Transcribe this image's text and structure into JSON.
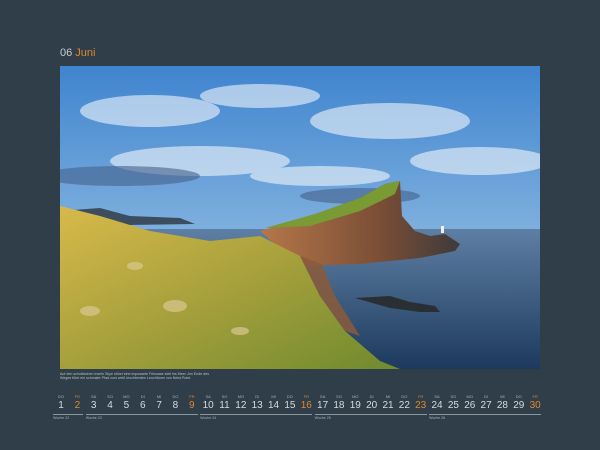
{
  "header": {
    "number": "06",
    "month": "Juni"
  },
  "photo": {
    "subject": "coastal-cliffs-with-lighthouse-at-sunset",
    "colors": {
      "sky": "#4f8fd0",
      "sea": "#2b4f78",
      "grass": "#b9a23a",
      "cliff": "#8a5a3a"
    }
  },
  "caption": "Auf den schottischen Inseln Skye stürzt eine imposante Felsnase steil ins Meer. Am Ende des Weges führt ein schmaler Pfad zum weiß leuchtenden Leuchtturm von Neist Point.",
  "calendar": {
    "days": [
      {
        "num": "1",
        "wd": "DO",
        "weekend": false
      },
      {
        "num": "2",
        "wd": "FR",
        "weekend": true
      },
      {
        "num": "3",
        "wd": "SA",
        "weekend": false
      },
      {
        "num": "4",
        "wd": "SO",
        "weekend": false
      },
      {
        "num": "5",
        "wd": "MO",
        "weekend": false
      },
      {
        "num": "6",
        "wd": "DI",
        "weekend": false
      },
      {
        "num": "7",
        "wd": "MI",
        "weekend": false
      },
      {
        "num": "8",
        "wd": "DO",
        "weekend": false
      },
      {
        "num": "9",
        "wd": "FR",
        "weekend": true
      },
      {
        "num": "10",
        "wd": "SA",
        "weekend": false
      },
      {
        "num": "11",
        "wd": "SO",
        "weekend": false
      },
      {
        "num": "12",
        "wd": "MO",
        "weekend": false
      },
      {
        "num": "13",
        "wd": "DI",
        "weekend": false
      },
      {
        "num": "14",
        "wd": "MI",
        "weekend": false
      },
      {
        "num": "15",
        "wd": "DO",
        "weekend": false
      },
      {
        "num": "16",
        "wd": "FR",
        "weekend": true
      },
      {
        "num": "17",
        "wd": "SA",
        "weekend": false
      },
      {
        "num": "18",
        "wd": "SO",
        "weekend": false
      },
      {
        "num": "19",
        "wd": "MO",
        "weekend": false
      },
      {
        "num": "20",
        "wd": "DI",
        "weekend": false
      },
      {
        "num": "21",
        "wd": "MI",
        "weekend": false
      },
      {
        "num": "22",
        "wd": "DO",
        "weekend": false
      },
      {
        "num": "23",
        "wd": "FR",
        "weekend": true
      },
      {
        "num": "24",
        "wd": "SA",
        "weekend": false
      },
      {
        "num": "25",
        "wd": "SO",
        "weekend": false
      },
      {
        "num": "26",
        "wd": "MO",
        "weekend": false
      },
      {
        "num": "27",
        "wd": "DI",
        "weekend": false
      },
      {
        "num": "28",
        "wd": "MI",
        "weekend": false
      },
      {
        "num": "29",
        "wd": "DO",
        "weekend": false
      },
      {
        "num": "30",
        "wd": "FR",
        "weekend": true
      }
    ],
    "weeks": [
      {
        "label": "Woche 22",
        "from": 0,
        "to": 1
      },
      {
        "label": "Woche 23",
        "from": 2,
        "to": 8
      },
      {
        "label": "Woche 24",
        "from": 9,
        "to": 15
      },
      {
        "label": "Woche 25",
        "from": 16,
        "to": 22
      },
      {
        "label": "Woche 26",
        "from": 23,
        "to": 29
      }
    ],
    "accent": "#e0872f"
  }
}
